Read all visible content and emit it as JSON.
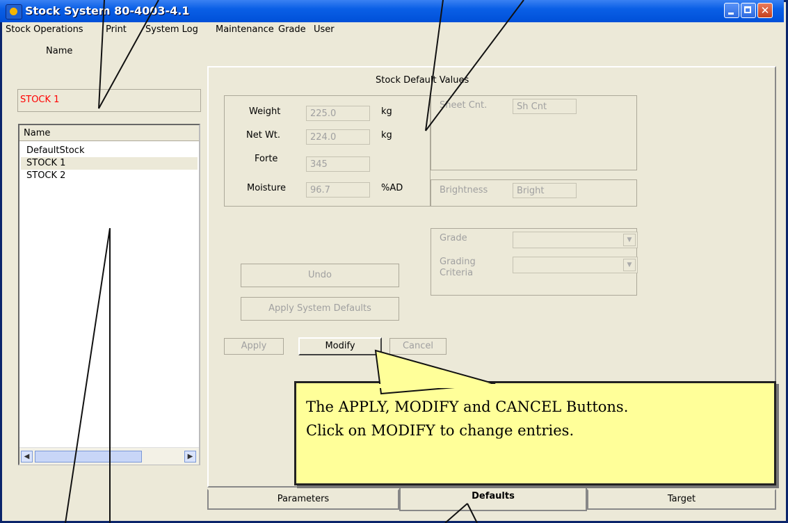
{
  "window": {
    "title": "Stock System 80-4003-4.1",
    "icon": "app-icon"
  },
  "menu": [
    "Stock Operations",
    "Print",
    "System Log",
    "Maintenance",
    "Grade",
    "User"
  ],
  "left_panel": {
    "name_label": "Name",
    "name_value": "STOCK 1",
    "name_value_color": "#FF0000",
    "list_header": "Name",
    "list_items": [
      "DefaultStock",
      "STOCK 1",
      "STOCK 2"
    ],
    "selected_index": 1
  },
  "panel": {
    "title": "Stock Default Values",
    "fields": [
      {
        "label": "Weight",
        "value": "225.0",
        "unit": "kg"
      },
      {
        "label": "Net Wt.",
        "value": "224.0",
        "unit": "kg"
      },
      {
        "label": "Forte",
        "value": "345",
        "unit": ""
      },
      {
        "label": "Moisture",
        "value": "96.7",
        "unit": "%AD"
      }
    ],
    "sheet_cnt_label": "Sheet Cnt.",
    "sheet_cnt_value": "Sh Cnt",
    "brightness_label": "Brightness",
    "brightness_value": "Bright",
    "grade_label": "Grade",
    "grading_criteria_label_1": "Grading",
    "grading_criteria_label_2": "Criteria",
    "undo_label": "Undo",
    "apply_defaults_label": "Apply System Defaults",
    "apply_label": "Apply",
    "modify_label": "Modify",
    "cancel_label": "Cancel"
  },
  "tabs": [
    "Parameters",
    "Defaults",
    "Target"
  ],
  "active_tab": "Defaults",
  "callout": {
    "line1": "The APPLY, MODIFY and CANCEL Buttons.",
    "line2": "Click on MODIFY to change entries.",
    "fill_color": "#FFFF99"
  }
}
